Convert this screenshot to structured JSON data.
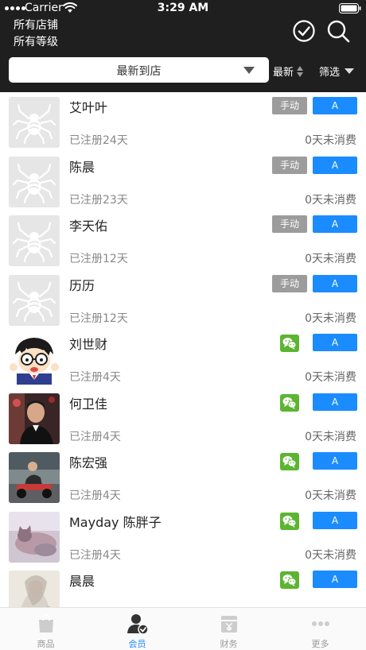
{
  "status_bar": {
    "carrier": "Carrier",
    "time": "3:29 AM"
  },
  "header": {
    "store_filter": "所有店铺",
    "level_filter": "所有等级",
    "sort_label": "最新到店",
    "newest_label": "最新",
    "filter_label": "筛选"
  },
  "members": [
    {
      "name": "艾叶叶",
      "registered": "已注册24天",
      "consumption": "0天未消费",
      "source": "manual",
      "source_label": "手动",
      "level": "A",
      "avatar": "placeholder"
    },
    {
      "name": "陈晨",
      "registered": "已注册23天",
      "consumption": "0天未消费",
      "source": "manual",
      "source_label": "手动",
      "level": "A",
      "avatar": "placeholder"
    },
    {
      "name": "李天佑",
      "registered": "已注册12天",
      "consumption": "0天未消费",
      "source": "manual",
      "source_label": "手动",
      "level": "A",
      "avatar": "placeholder"
    },
    {
      "name": "历历",
      "registered": "已注册12天",
      "consumption": "0天未消费",
      "source": "manual",
      "source_label": "手动",
      "level": "A",
      "avatar": "placeholder"
    },
    {
      "name": "刘世财",
      "registered": "已注册4天",
      "consumption": "0天未消费",
      "source": "wechat",
      "source_label": "",
      "level": "A",
      "avatar": "cartoon"
    },
    {
      "name": "何卫佳",
      "registered": "已注册4天",
      "consumption": "0天未消费",
      "source": "wechat",
      "source_label": "",
      "level": "A",
      "avatar": "photo-man"
    },
    {
      "name": "陈宏强",
      "registered": "已注册4天",
      "consumption": "0天未消费",
      "source": "wechat",
      "source_label": "",
      "level": "A",
      "avatar": "photo-kart"
    },
    {
      "name": "Mayday 陈胖子",
      "registered": "已注册4天",
      "consumption": "0天未消费",
      "source": "wechat",
      "source_label": "",
      "level": "A",
      "avatar": "photo-cat"
    },
    {
      "name": "晨晨",
      "registered": "",
      "consumption": "",
      "source": "wechat",
      "source_label": "",
      "level": "A",
      "avatar": "photo-art"
    }
  ],
  "tabbar": {
    "tabs": [
      {
        "label": "商品",
        "icon": "bag-icon",
        "active": false
      },
      {
        "label": "会员",
        "icon": "member-icon",
        "active": true
      },
      {
        "label": "财务",
        "icon": "finance-icon",
        "active": false
      },
      {
        "label": "更多",
        "icon": "more-icon",
        "active": false
      }
    ]
  },
  "colors": {
    "header_bg": "#1f1f1f",
    "accent": "#1a8cff",
    "manual_badge": "#9c9c9c",
    "wechat": "#5cb531"
  }
}
